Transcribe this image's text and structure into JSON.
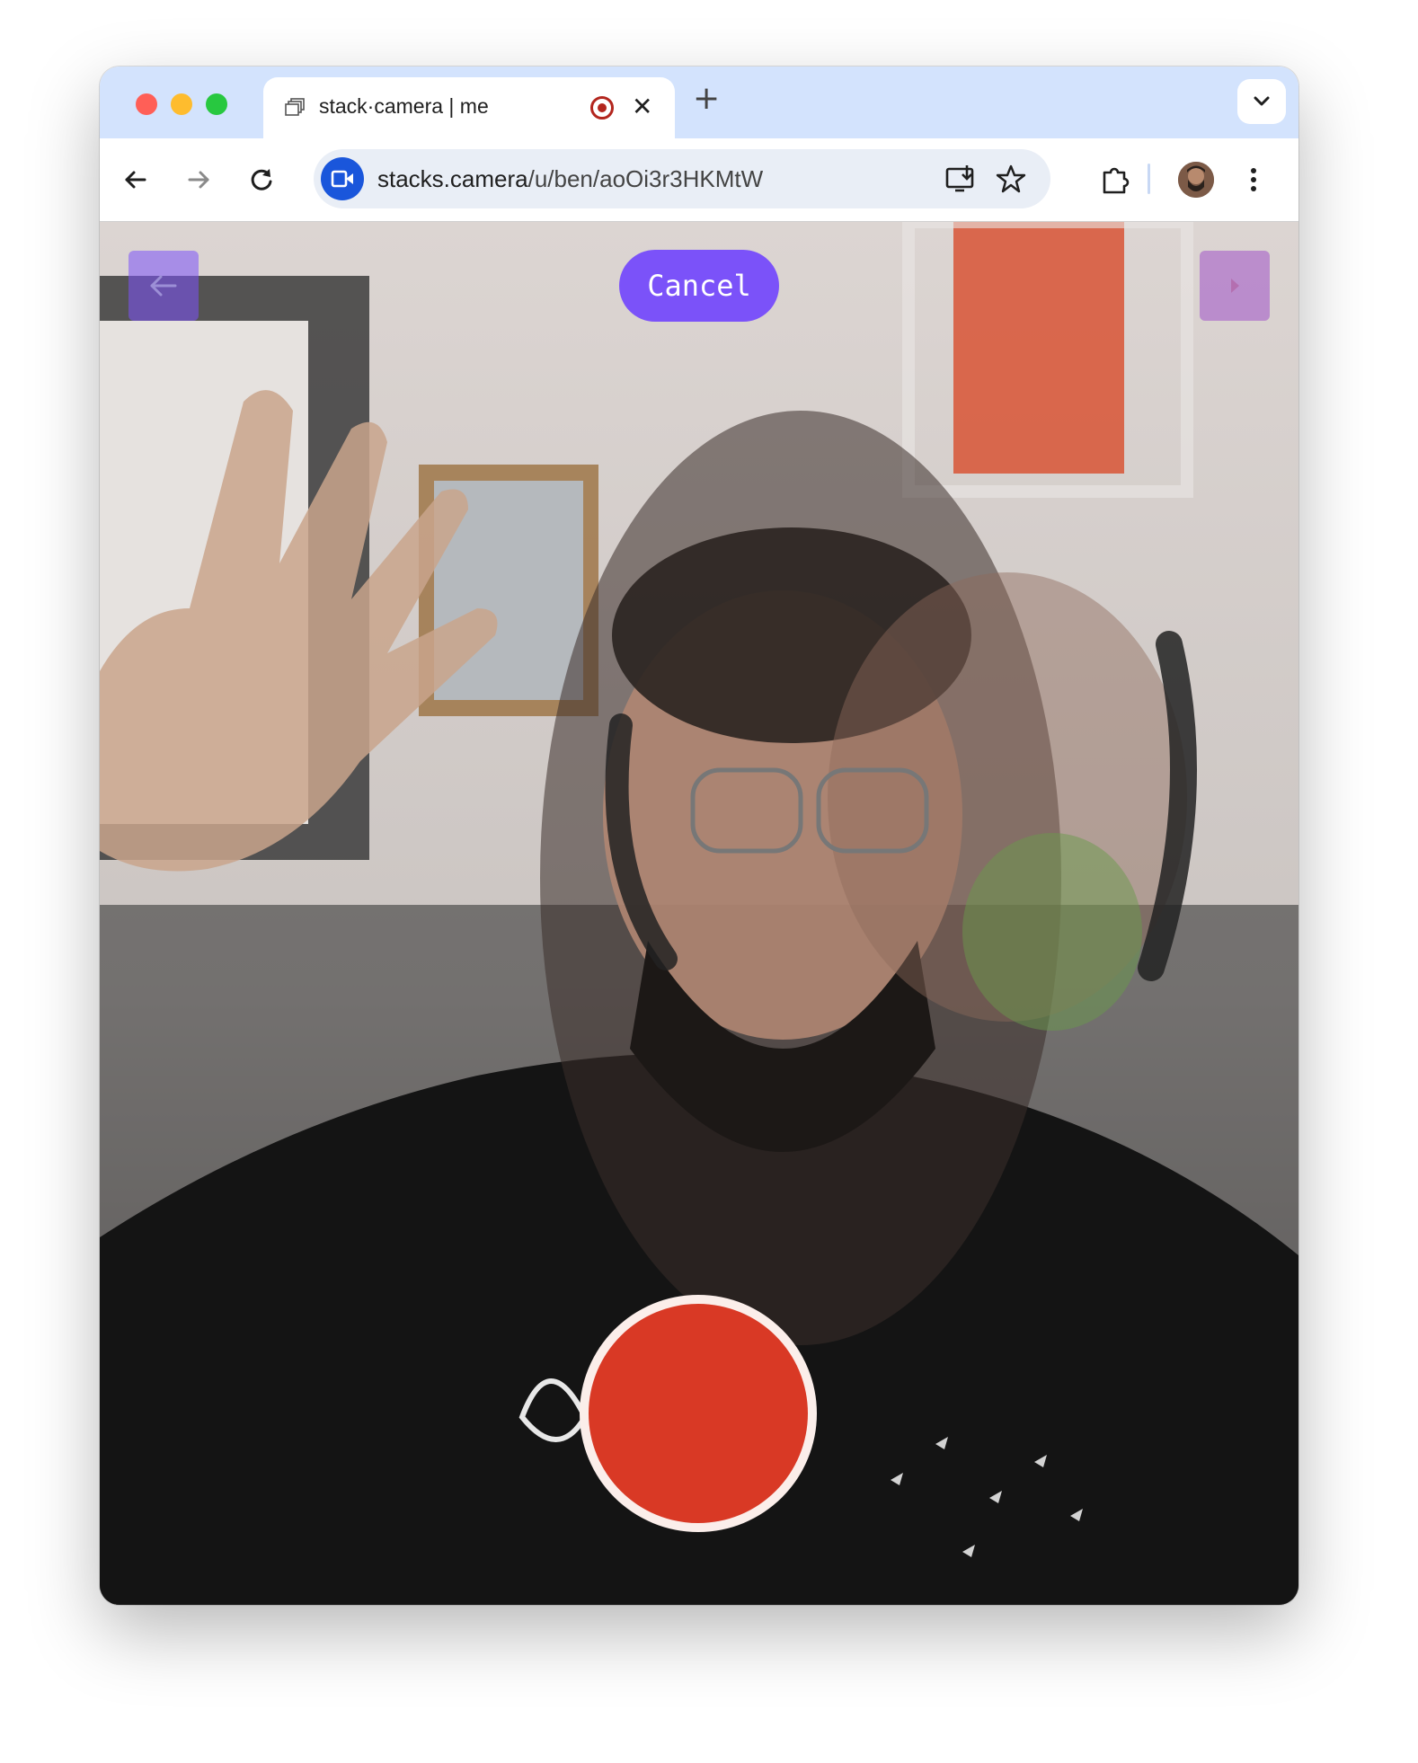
{
  "browser": {
    "tab": {
      "title": "stack·camera | me",
      "favicon": "stack-icon",
      "recording_indicator": "recording-icon",
      "close_icon": "close-icon"
    },
    "new_tab_icon": "plus-icon",
    "tab_search_icon": "chevron-down-icon",
    "toolbar": {
      "back_icon": "arrow-left-icon",
      "forward_icon": "arrow-right-icon",
      "reload_icon": "reload-icon",
      "url_host": "stacks.camera",
      "url_path": "/u/ben/aoOi3r3HKMtW",
      "site_icon": "video-camera-icon",
      "install_icon": "install-app-icon",
      "bookmark_icon": "star-icon",
      "extensions_icon": "puzzle-icon",
      "menu_icon": "more-vertical-icon"
    }
  },
  "camera": {
    "cancel_label": "Cancel",
    "prev_icon": "arrow-left-icon",
    "next_icon": "play-icon",
    "shutter_icon": "record-button",
    "colors": {
      "accent": "#7b52f9",
      "record": "#d93925"
    }
  }
}
